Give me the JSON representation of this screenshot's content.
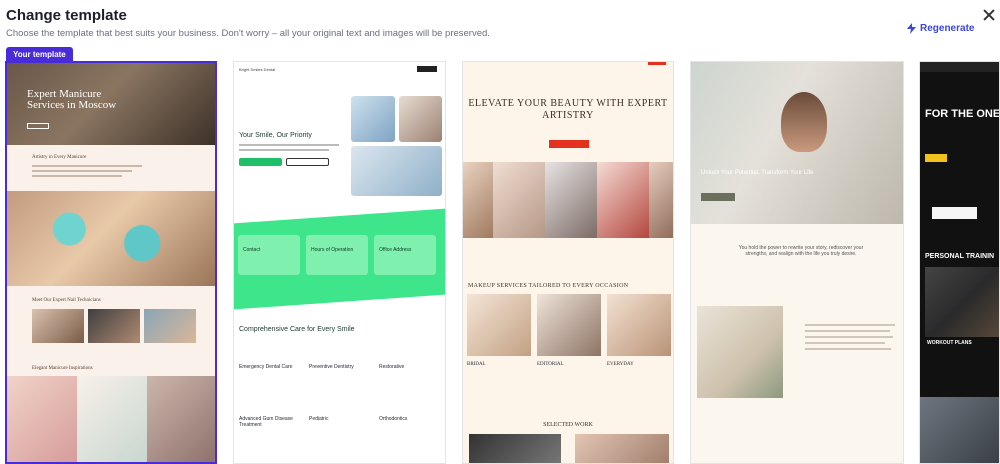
{
  "header": {
    "title": "Change template",
    "subtitle": "Choose the template that best suits your business. Don't worry – all your original text and images will be preserved.",
    "regenerate_label": "Regenerate"
  },
  "templates": [
    {
      "badge": "Your template",
      "hero_title": "Expert Manicure Services in Moscow",
      "section1_title": "Artistry in Every Manicure",
      "section2_title": "Meet Our Expert Nail Technicians",
      "section3_title": "Elegant Manicure Inspirations"
    },
    {
      "nav_brand": "Bright Smiles Dental",
      "hero_title": "Your Smile, Our Priority",
      "box_labels": [
        "Contact",
        "Hours of Operation",
        "Office Address"
      ],
      "section_title": "Comprehensive Care for Every Smile",
      "features": [
        "Emergency Dental Care",
        "Preventive Dentistry",
        "Restorative",
        "Advanced Gum Disease Treatment",
        "Pediatric",
        "Orthodontics"
      ]
    },
    {
      "heading": "ELEVATE YOUR BEAUTY WITH EXPERT ARTISTRY",
      "section_title": "MAKEUP SERVICES TAILORED TO EVERY OCCASION",
      "captions": [
        "BRIDAL",
        "EDITORIAL",
        "EVERYDAY"
      ],
      "selected_work": "SELECTED WORK"
    },
    {
      "hero_text": "Unlock Your Potential, Transform Your Life",
      "paragraph": "You hold the power to rewrite your story, rediscover your strengths, and realign with the life you truly desire."
    },
    {
      "big_title": "FOR THE ONE DOES NOT Q",
      "section_title": "PERSONAL TRAININ",
      "tile": "WORKOUT PLANS"
    }
  ],
  "colors": {
    "accent": "#4a2bd8",
    "link": "#3b47d9",
    "mint": "#3ee58b",
    "cta_red": "#e3301f"
  }
}
